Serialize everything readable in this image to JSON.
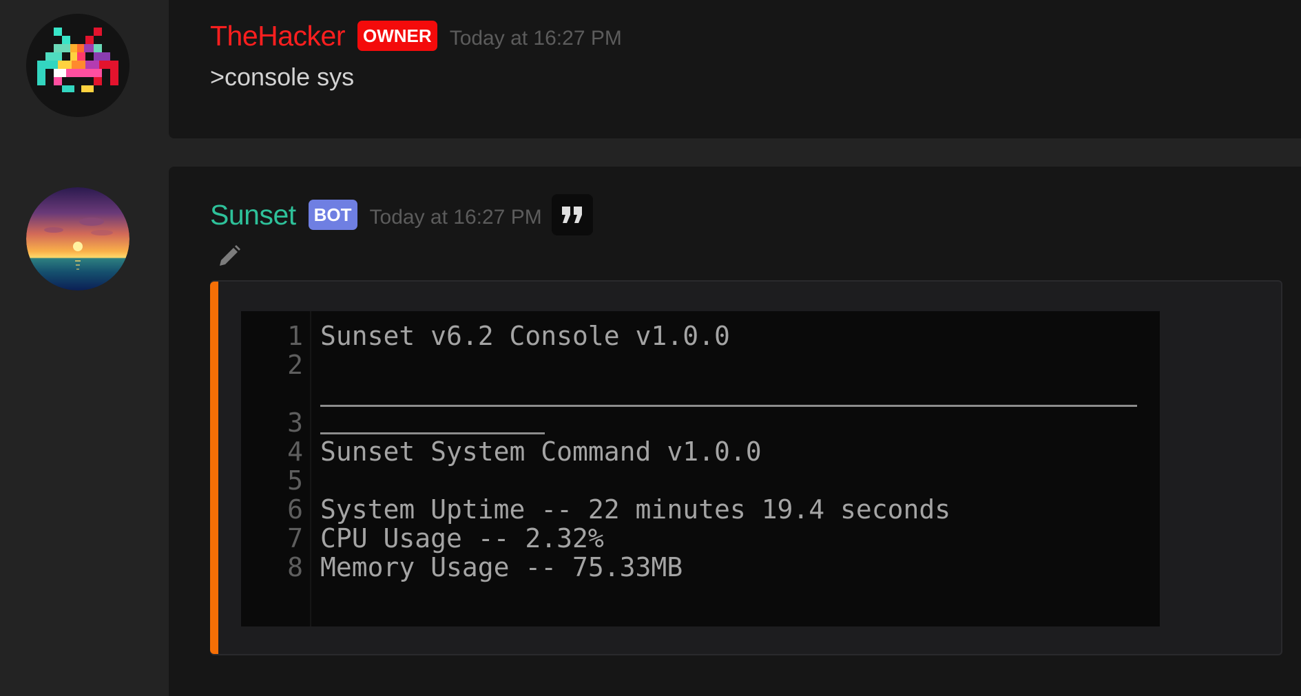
{
  "messages": [
    {
      "username": "TheHacker",
      "badge": "OWNER",
      "timestamp": "Today at 16:27 PM",
      "content": ">console sys",
      "name_color": "#ff1f1f",
      "badge_color": "#f40b0b"
    },
    {
      "username": "Sunset",
      "badge": "BOT",
      "timestamp": "Today at 16:27 PM",
      "name_color": "#2ec19a",
      "badge_color": "#6f7fe2",
      "embed": {
        "accent_color": "#f56f06",
        "line_numbers": [
          "1",
          "2",
          "3",
          "4",
          "5",
          "6",
          "7",
          "8"
        ],
        "lines": [
          "Sunset v6.2 Console v1.0.0",
          "",
          "",
          "Sunset System Command v1.0.0",
          "",
          "System Uptime -- 22 minutes 19.4 seconds",
          "CPU Usage -- 2.32%",
          "Memory Usage -- 75.33MB"
        ]
      }
    }
  ],
  "icons": {
    "quote": "quote-icon",
    "edit": "pencil-icon"
  }
}
